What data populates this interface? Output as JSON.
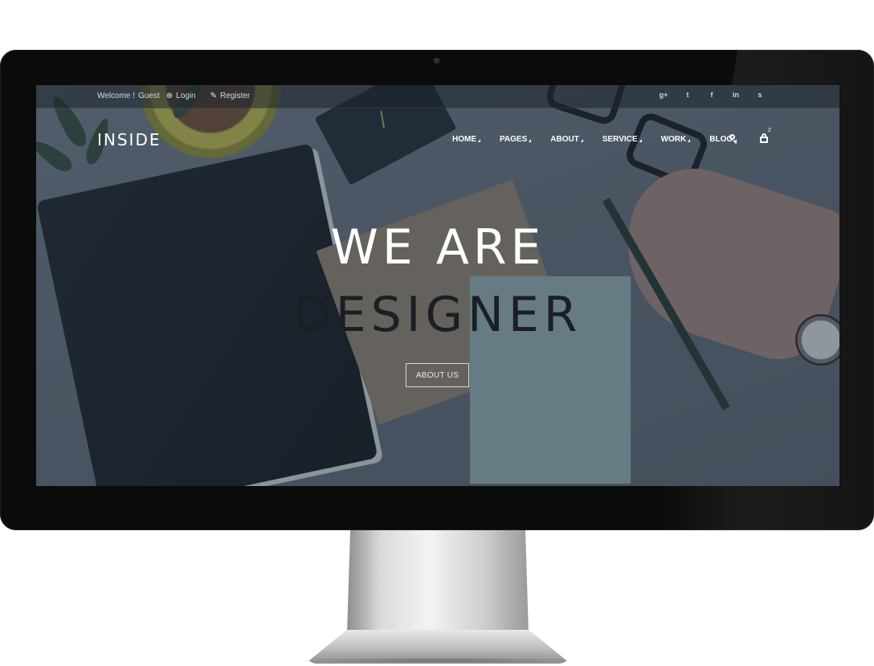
{
  "topbar": {
    "welcome": "Welcome !",
    "guest": "Guest",
    "login": "Login",
    "register": "Register",
    "socials": [
      {
        "icon": "google-plus-icon",
        "glyph": "g+"
      },
      {
        "icon": "twitter-icon",
        "glyph": "t"
      },
      {
        "icon": "facebook-icon",
        "glyph": "f"
      },
      {
        "icon": "linkedin-icon",
        "glyph": "in"
      },
      {
        "icon": "skype-icon",
        "glyph": "s"
      }
    ]
  },
  "header": {
    "logo": "INSIDE",
    "nav": [
      "HOME",
      "PAGES",
      "ABOUT",
      "SERVICE",
      "WORK",
      "BLOG"
    ],
    "cart_count": "2"
  },
  "hero": {
    "line1": "WE ARE",
    "line2": "DESIGNER",
    "button": "ABOUT US"
  }
}
